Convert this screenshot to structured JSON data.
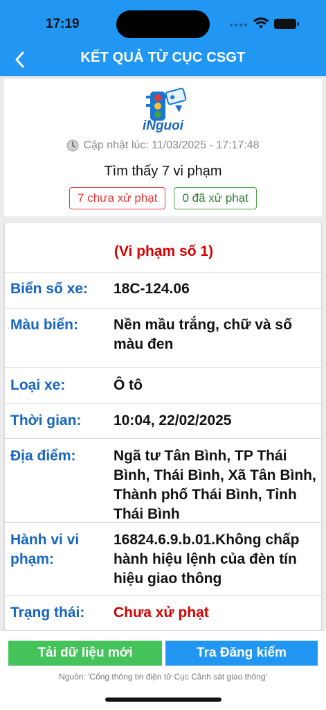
{
  "status_bar": {
    "time": "17:19"
  },
  "header": {
    "title": "KẾT QUẢ TỪ CỤC CSGT"
  },
  "info": {
    "logo_text": "iNguoi",
    "update_text": "Cập nhật lúc: 11/03/2025 - 17:17:48",
    "found_text": "Tìm thấy 7 vi phạm",
    "unpaid_badge": "7 chưa xử phạt",
    "paid_badge": "0 đã xử phạt"
  },
  "violation": {
    "title": "(Vi phạm số 1)",
    "rows": [
      {
        "label": "Biển số xe:",
        "value": "18C-124.06"
      },
      {
        "label": "Màu biển:",
        "value": "Nền mầu trắng, chữ và số màu đen"
      },
      {
        "label": "Loại xe:",
        "value": "Ô tô"
      },
      {
        "label": "Thời gian:",
        "value": "10:04, 22/02/2025"
      },
      {
        "label": "Địa điểm:",
        "value": "Ngã tư Tân Bình, TP Thái Bình, Thái Bình, Xã Tân Bình, Thành phố Thái Bình, Tỉnh Thái Bình"
      },
      {
        "label": "Hành vi vi phạm:",
        "value": "16824.6.9.b.01.Không chấp hành hiệu lệnh của đèn tín hiệu giao thông"
      },
      {
        "label": "Trạng thái:",
        "value": "Chưa xử phạt"
      }
    ]
  },
  "buttons": {
    "reload": "Tải dữ liệu mới",
    "inspection": "Tra Đăng kiểm"
  },
  "source_text": "Nguồn: 'Cổng thông tin điện tử Cục Cảnh sát giao thông'",
  "colors": {
    "primary": "#2196F3",
    "label_blue": "#1565C0",
    "danger": "#d50000",
    "success": "#43c35a"
  }
}
